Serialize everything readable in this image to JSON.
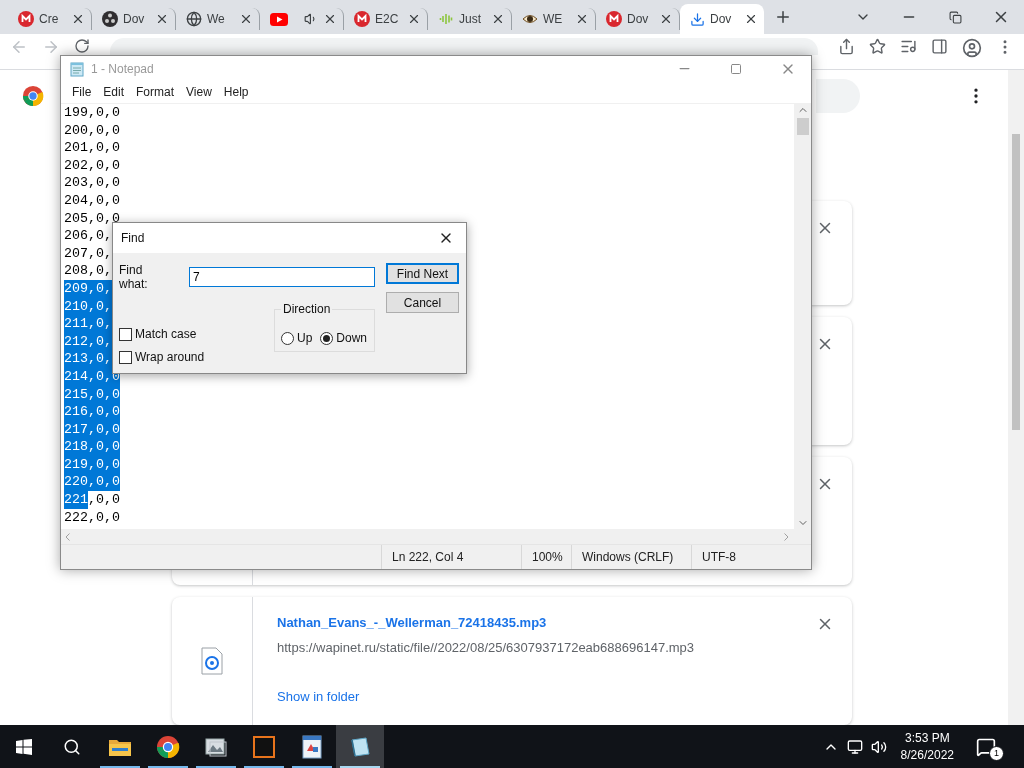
{
  "browser": {
    "tabs": [
      {
        "title": "Cre",
        "audio": false,
        "selected": false
      },
      {
        "title": "Dov",
        "audio": false,
        "selected": false
      },
      {
        "title": "We",
        "audio": false,
        "selected": false
      },
      {
        "audio": true,
        "selected": false
      },
      {
        "title": "E2C",
        "audio": false,
        "selected": false
      },
      {
        "title": "Just",
        "audio": false,
        "selected": false
      },
      {
        "title": "WE",
        "audio": false,
        "selected": false
      },
      {
        "title": "Dov",
        "audio": false,
        "selected": false
      },
      {
        "title": "Dov",
        "audio": false,
        "selected": true
      }
    ],
    "downloads": [
      {
        "kind": "covered"
      },
      {
        "kind": "covered"
      },
      {
        "kind": "covered"
      },
      {
        "kind": "file",
        "file_name": "Nathan_Evans_-_Wellerman_72418435.mp3",
        "url": "https://wapinet.ru/static/file//2022/08/25/6307937172eab688696147.mp3",
        "action": "Show in folder"
      }
    ]
  },
  "notepad": {
    "title": "1 - Notepad",
    "menu": [
      "File",
      "Edit",
      "Format",
      "View",
      "Help"
    ],
    "lines": [
      {
        "text": "199,0,0",
        "selected": false
      },
      {
        "text": "200,0,0",
        "selected": false
      },
      {
        "text": "201,0,0",
        "selected": false
      },
      {
        "text": "202,0,0",
        "selected": false
      },
      {
        "text": "203,0,0",
        "selected": false
      },
      {
        "text": "204,0,0",
        "selected": false
      },
      {
        "text": "205,0,0",
        "selected": false
      },
      {
        "text": "206,0,",
        "selected": false
      },
      {
        "text": "207,0,",
        "selected": false
      },
      {
        "text": "208,0,",
        "selected": false
      },
      {
        "text": "209,0,",
        "selected": true
      },
      {
        "text": "210,0,",
        "selected": true
      },
      {
        "text": "211,0,",
        "selected": true
      },
      {
        "text": "212,0,",
        "selected": true
      },
      {
        "text": "213,0,",
        "selected": true
      },
      {
        "text": "214,0,0",
        "selected": true
      },
      {
        "text": "215,0,0",
        "selected": true
      },
      {
        "text": "216,0,0",
        "selected": true
      },
      {
        "text": "217,0,0",
        "selected": true
      },
      {
        "text": "218,0,0",
        "selected": true
      },
      {
        "text": "219,0,0",
        "selected": true
      },
      {
        "text": "220,0,0",
        "selected": true
      },
      {
        "text": "221",
        "selected": true,
        "tail": ",0,0"
      },
      {
        "text": "222,0,0",
        "selected": false
      }
    ],
    "status": [
      "Ln 222, Col 4",
      "100%",
      "Windows (CRLF)",
      "UTF-8"
    ]
  },
  "find_dialog": {
    "title": "Find",
    "label": "Find what:",
    "value": "7",
    "buttons": [
      {
        "label": "Find Next",
        "default": true
      },
      {
        "label": "Cancel",
        "default": false
      }
    ],
    "direction": {
      "label": "Direction",
      "options": [
        {
          "label": "Up",
          "selected": false
        },
        {
          "label": "Down",
          "selected": true
        }
      ]
    },
    "checkboxes": [
      {
        "label": "Match case",
        "checked": false
      },
      {
        "label": "Wrap around",
        "checked": false
      }
    ]
  },
  "taskbar": {
    "apps": [
      {
        "running": true,
        "active": false
      },
      {
        "running": true,
        "active": false
      },
      {
        "running": true,
        "active": false
      },
      {
        "running": true,
        "active": false
      },
      {
        "running": true,
        "active": false
      },
      {
        "running": true,
        "active": true
      }
    ],
    "time": "3:53 PM",
    "date": "8/26/2022",
    "notifications": "1"
  }
}
